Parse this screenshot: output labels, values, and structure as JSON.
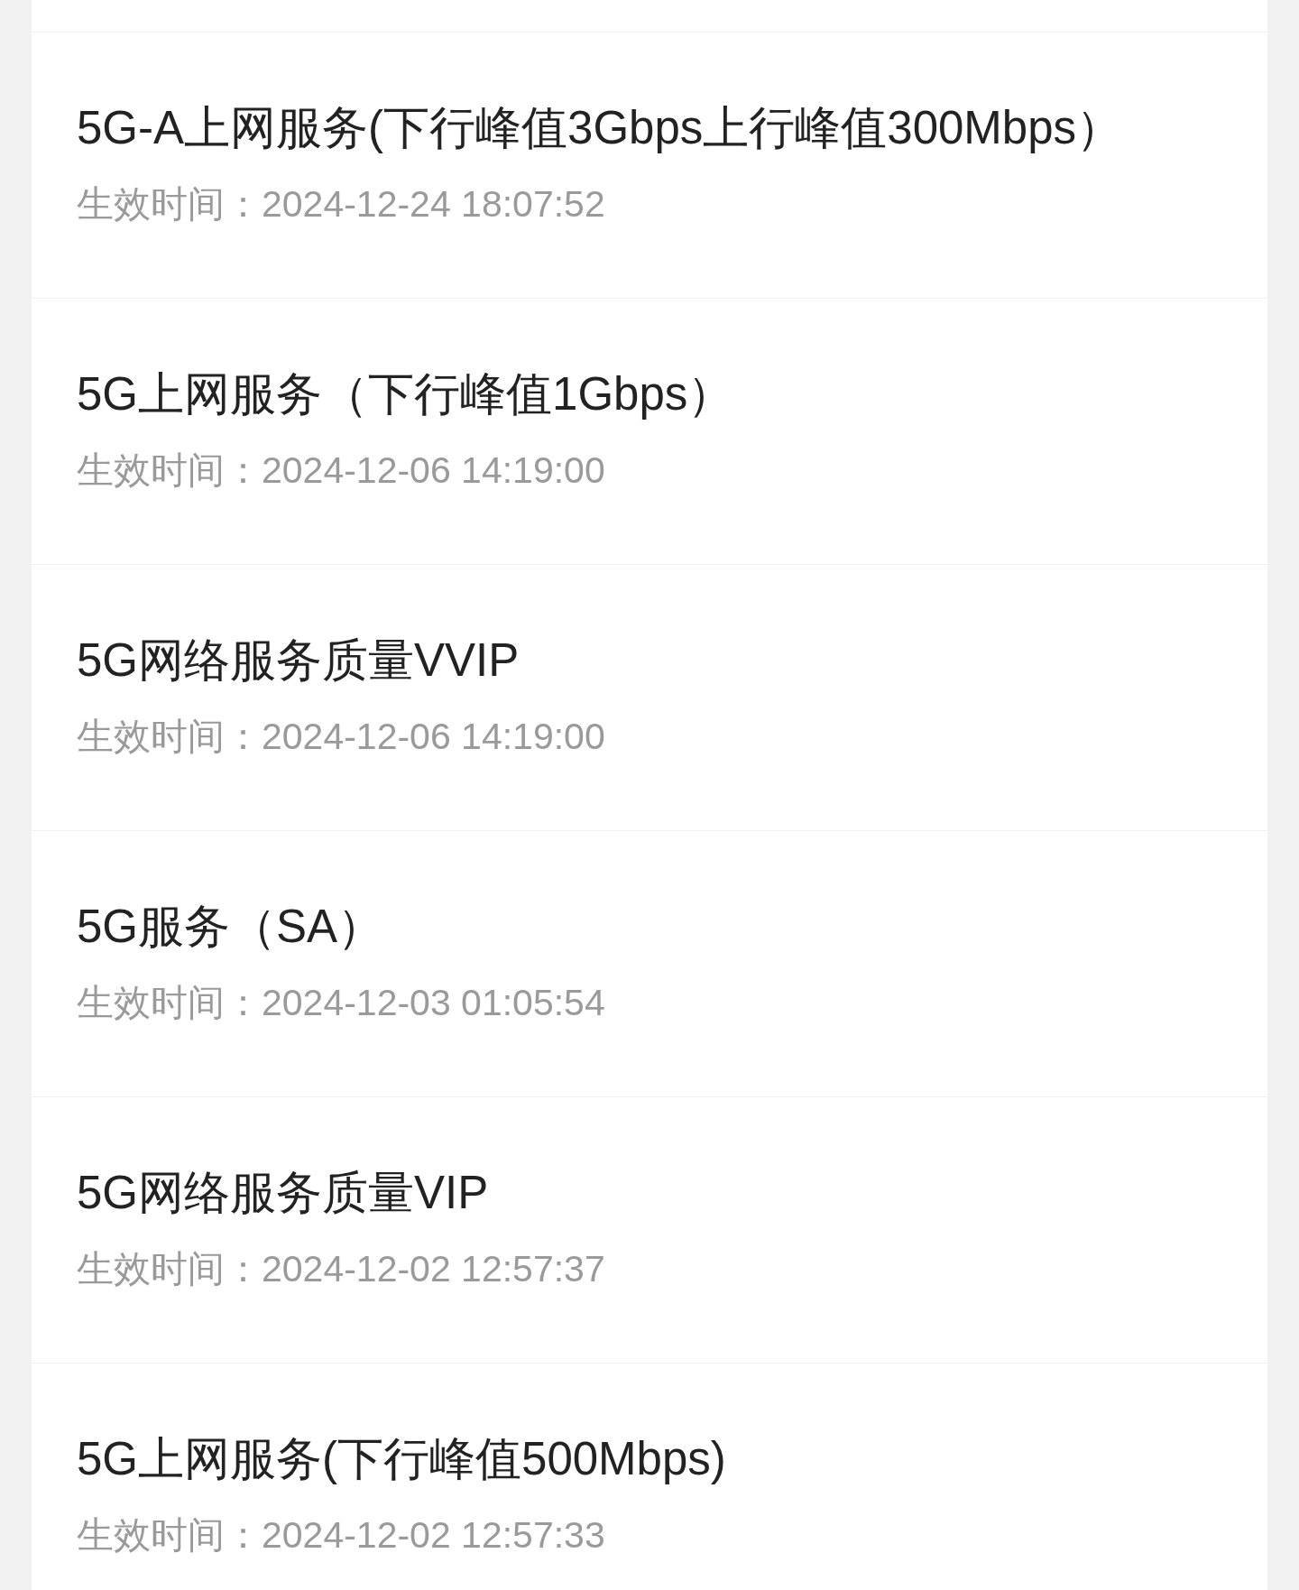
{
  "services": [
    {
      "title": "5G-A上网服务(下行峰值3Gbps上行峰值300Mbps）",
      "effective_time": "生效时间：2024-12-24 18:07:52"
    },
    {
      "title": "5G上网服务（下行峰值1Gbps）",
      "effective_time": "生效时间：2024-12-06 14:19:00"
    },
    {
      "title": "5G网络服务质量VVIP",
      "effective_time": "生效时间：2024-12-06 14:19:00"
    },
    {
      "title": "5G服务（SA）",
      "effective_time": "生效时间：2024-12-03 01:05:54"
    },
    {
      "title": "5G网络服务质量VIP",
      "effective_time": "生效时间：2024-12-02 12:57:37"
    },
    {
      "title": "5G上网服务(下行峰值500Mbps)",
      "effective_time": "生效时间：2024-12-02 12:57:33"
    }
  ]
}
